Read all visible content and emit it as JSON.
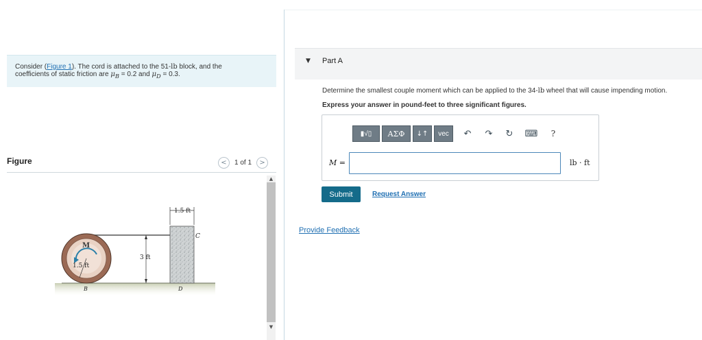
{
  "problem": {
    "prefix": "Consider (",
    "figure_link": "Figure 1",
    "after_link": "). The cord is attached to the 51-",
    "weight_unit": "lb",
    "after_weight": " block, and the",
    "line2_start": "coefficients of static friction are ",
    "mu": "μ",
    "sub_b": "B",
    "value_b": " = 0.2 and ",
    "sub_d": "D",
    "value_d": " = 0.3."
  },
  "figure": {
    "heading": "Figure",
    "pager_prev": "<",
    "pager_text": "1 of 1",
    "pager_next": ">",
    "labels": {
      "dim_top": "1.5 ft",
      "point_c": "C",
      "height": "3 ft",
      "moment": "M",
      "radius": "1.5 ft",
      "point_b": "B",
      "point_d": "D"
    },
    "scroll_up": "▲",
    "scroll_down": "▼"
  },
  "part": {
    "caret": "▼",
    "title": "Part A",
    "question_a": "Determine the smallest couple moment which can be applied to the 34-",
    "question_unit": "lb",
    "question_b": " wheel that will cause impending motion.",
    "instruction": "Express your answer in pound-feet to three significant figures."
  },
  "toolbar": {
    "template_label": "▮√▯",
    "greek_label": "ΑΣΦ",
    "arrows_label": "↓↑",
    "vec_label": "vec",
    "undo_glyph": "↶",
    "redo_glyph": "↷",
    "reset_glyph": "↻",
    "keyboard_glyph": "⌨",
    "help_glyph": "?"
  },
  "answer": {
    "variable": "M",
    "equals": " =",
    "value": "",
    "unit": "lb · ft"
  },
  "actions": {
    "submit": "Submit",
    "request": "Request Answer",
    "feedback": "Provide Feedback"
  }
}
